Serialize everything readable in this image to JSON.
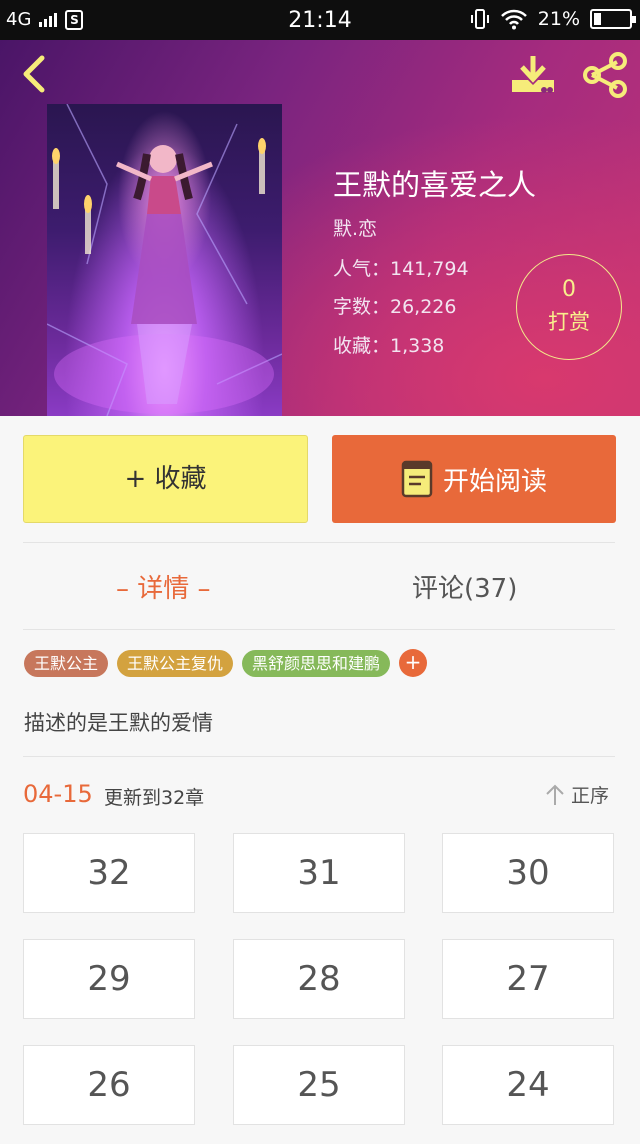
{
  "status_bar": {
    "network": "4G",
    "sim_label": "S",
    "time": "21:14",
    "battery": "21%",
    "battery_level": 0.21
  },
  "book": {
    "title": "王默的喜爱之人",
    "author": "默.恋",
    "popularity": "人气：141,794",
    "word_count": "字数：26,226",
    "favorites": "收藏：1,338"
  },
  "tip": {
    "count": "0",
    "label": "打赏"
  },
  "actions": {
    "favorite": "+ 收藏",
    "read": "开始阅读"
  },
  "tabs": {
    "detail": "– 详情 –",
    "comments": "评论(37)"
  },
  "tags": [
    {
      "label": "王默公主",
      "color": "#c7775c"
    },
    {
      "label": "王默公主复仇",
      "color": "#d3a23f"
    },
    {
      "label": "黑舒颜思思和建鹏",
      "color": "#86b95a"
    }
  ],
  "tag_add": "+",
  "description": "描述的是王默的爱情",
  "update": {
    "date": "04-15",
    "text": "更新到32章",
    "sort_label": "正序"
  },
  "chapters": [
    "32",
    "31",
    "30",
    "29",
    "28",
    "27",
    "26",
    "25",
    "24"
  ],
  "colors": {
    "accent": "#e8693a",
    "favorite_button": "#fbf37a",
    "icon_yellow": "#f6ec7a"
  }
}
